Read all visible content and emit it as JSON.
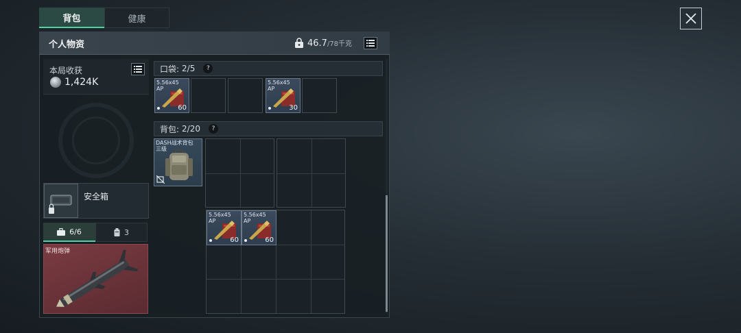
{
  "tabs": [
    {
      "label": "背包",
      "active": true
    },
    {
      "label": "健康",
      "active": false
    }
  ],
  "panel": {
    "title": "个人物资",
    "weight_current": "46.7",
    "weight_max": "/78千克"
  },
  "earnings": {
    "label": "本局收获",
    "value": "1,424K"
  },
  "safe_box": {
    "label": "安全箱"
  },
  "stat_tabs": [
    {
      "value": "6/6",
      "icon": "briefcase-icon"
    },
    {
      "value": "3",
      "icon": "canister-icon"
    }
  ],
  "red_item": {
    "label": "军用炮弹"
  },
  "pocket": {
    "label": "口袋:",
    "count": "2/5",
    "help": "?"
  },
  "backpack": {
    "label": "背包:",
    "count": "2/20",
    "help": "?",
    "item_name": "DASH战术背包\n三级"
  },
  "ammo": [
    {
      "name": "5.56x45\nAP",
      "count": "60"
    },
    {
      "name": "5.56x45\nAP",
      "count": "30"
    },
    {
      "name": "5.56x45\nAP",
      "count": "60"
    },
    {
      "name": "5.56x45\nAP",
      "count": "60"
    }
  ],
  "colors": {
    "accent": "#54d1a3",
    "item_blue": "#3a4a5c",
    "item_red": "#7a3b41"
  }
}
